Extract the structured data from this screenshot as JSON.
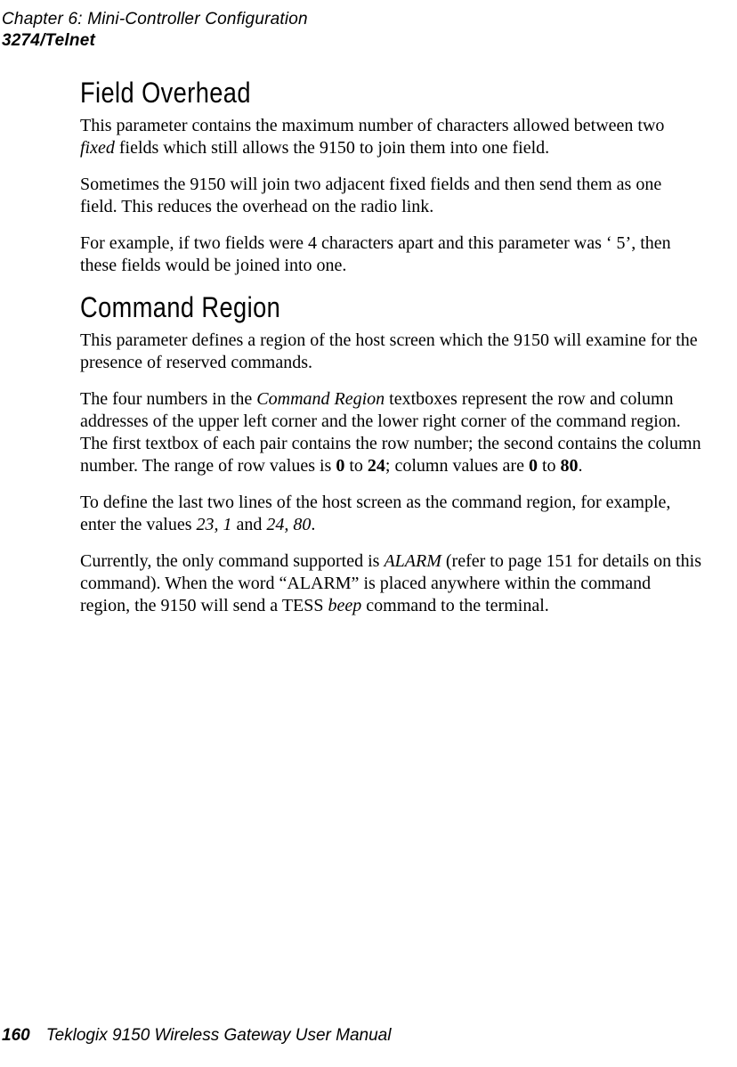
{
  "header": {
    "chapter_line": "Chapter 6:  Mini-Controller Configuration",
    "section_line": "3274/Telnet"
  },
  "sections": {
    "field_overhead": {
      "heading": "Field Overhead",
      "p1_a": "This parameter contains the maximum number of characters allowed between two ",
      "p1_fixed": "fixed",
      "p1_b": " fields which still allows the 9150 to join them into one field.",
      "p2": "Sometimes the 9150 will join two adjacent fixed fields and then send them as one field. This reduces the overhead on the radio link.",
      "p3": "For example, if two fields were 4 characters apart and this parameter was ‘ 5’, then these fields would be joined into one."
    },
    "command_region": {
      "heading": "Command Region",
      "p1": "This parameter defines a region of the host screen which the 9150 will examine for the presence of reserved commands.",
      "p2_a": "The four numbers in the ",
      "p2_cmd": "Command Region",
      "p2_b": " textboxes represent the row and column addresses of the upper left corner and the lower right corner of the command region. The first textbox of each pair contains the row number; the second contains the column number. The range of row values is ",
      "p2_zero1": "0",
      "p2_to1": " to ",
      "p2_24": "24",
      "p2_mid": "; column values are ",
      "p2_zero2": "0",
      "p2_to2": " to ",
      "p2_80": "80",
      "p2_end": ".",
      "p3_a": "To define the last two lines of the host screen as the command region, for example, enter the values ",
      "p3_231": "23, 1",
      "p3_and": " and ",
      "p3_2480": "24, 80",
      "p3_end": ".",
      "p4_a": "Currently, the only command supported is ",
      "p4_alarm": "ALARM",
      "p4_b": " (refer to page 151 for details on this command). When the word “ALARM” is placed anywhere within the command region, the 9150 will send a TESS ",
      "p4_beep": "beep",
      "p4_c": " command to the terminal."
    }
  },
  "footer": {
    "page_number": "160",
    "manual_title": "Teklogix 9150 Wireless Gateway User Manual"
  }
}
